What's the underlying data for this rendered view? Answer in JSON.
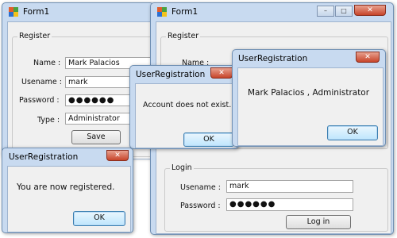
{
  "form_left": {
    "title": "Form1",
    "group_register": "Register",
    "name_label": "Name :",
    "name_value": "Mark Palacios",
    "username_label": "Usename :",
    "username_value": "mark",
    "password_label": "Password :",
    "password_value": "●●●●●●",
    "type_label": "Type :",
    "type_value": "Administrator",
    "save_label": "Save"
  },
  "form_right": {
    "title": "Form1",
    "group_register": "Register",
    "name_label": "Name :",
    "group_login": "Login",
    "username_label": "Usename :",
    "username_value": "mark",
    "password_label": "Password :",
    "password_value": "●●●●●●",
    "login_label": "Log in"
  },
  "msg_registered": {
    "title": "UserRegistration",
    "text": "You are now registered.",
    "ok": "OK"
  },
  "msg_not_exist": {
    "title": "UserRegistration",
    "text": "Account does not exist.",
    "ok": "OK"
  },
  "msg_admin": {
    "title": "UserRegistration",
    "text": "Mark Palacios , Administrator",
    "ok": "OK"
  },
  "icons": {
    "form": "form-icon",
    "close": "close-icon",
    "minimize": "minimize-icon",
    "maximize": "maximize-icon"
  },
  "colors": {
    "titlebar": "#c8daf0",
    "client": "#f0f0f0",
    "close": "#c7442a"
  }
}
